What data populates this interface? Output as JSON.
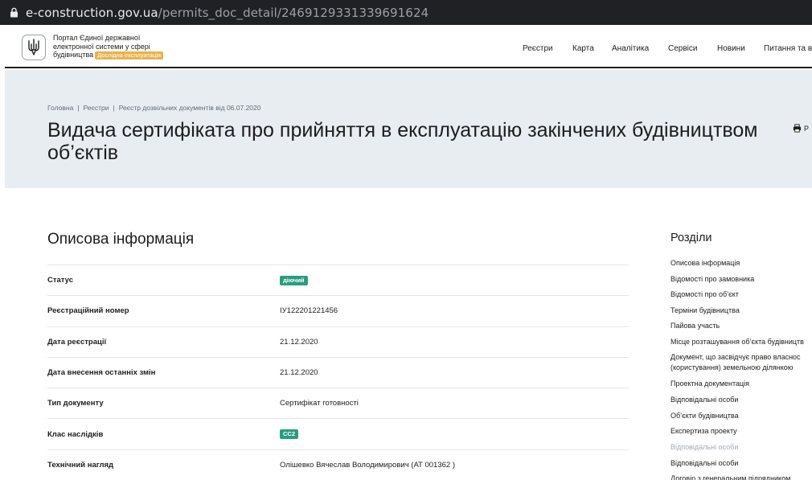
{
  "browser": {
    "url_domain": "e-construction.gov.ua",
    "url_path": "/permits_doc_detail/2469129331339691624"
  },
  "header": {
    "portal_line1": "Портал Єдиної державної",
    "portal_line2": "електронної системи у сфері",
    "portal_line3": "будівництва",
    "beta_badge": "Дослідна експлуатація",
    "nav": [
      {
        "label": "Реєстри"
      },
      {
        "label": "Карта"
      },
      {
        "label": "Аналітика"
      },
      {
        "label": "Сервіси"
      },
      {
        "label": "Новини"
      },
      {
        "label": "Питання та в"
      }
    ]
  },
  "hero": {
    "breadcrumb": [
      "Головна",
      "Реєстри",
      "Реєстр дозвільних документів від 06.07.2020"
    ],
    "title": "Видача сертифіката про прийняття в експлуатацію закінчених будівництвом об’єктів",
    "print_label": "Р"
  },
  "main": {
    "section_title": "Описова інформація",
    "rows": [
      {
        "label": "Статус",
        "value": "діючий",
        "badge": true
      },
      {
        "label": "Реєстраційний номер",
        "value": "ІУ122201221456",
        "badge": false
      },
      {
        "label": "Дата реєстрації",
        "value": "21.12.2020",
        "badge": false
      },
      {
        "label": "Дата внесення останніх змін",
        "value": "21.12.2020",
        "badge": false
      },
      {
        "label": "Тип документу",
        "value": "Сертифікат готовності",
        "badge": false
      },
      {
        "label": "Клас наслідків",
        "value": "СС2",
        "badge": true
      },
      {
        "label": "Технічний нагляд",
        "value": "Олішевко Вячеслав Володимирович (АТ 001362 )",
        "badge": false
      }
    ]
  },
  "sidebar": {
    "title": "Розділи",
    "items": [
      {
        "label": "Описова інформація",
        "muted": false
      },
      {
        "label": "Відомості про замовника",
        "muted": false
      },
      {
        "label": "Відомості про об’єкт",
        "muted": false
      },
      {
        "label": "Терміни будівництва",
        "muted": false
      },
      {
        "label": "Пайова участь",
        "muted": false
      },
      {
        "label": "Місце розташування об’єкта будівництв",
        "muted": false
      },
      {
        "label": "Документ, що засвідчує право власнос",
        "muted": false
      },
      {
        "label": "(користування) земельною ділянкою",
        "muted": false
      },
      {
        "label": "Проектна документація",
        "muted": false
      },
      {
        "label": "Відповідальні особи",
        "muted": false
      },
      {
        "label": "Об’єкти будівництва",
        "muted": false
      },
      {
        "label": "Експертиза проекту",
        "muted": false
      },
      {
        "label": "Відповідальні особи",
        "muted": true
      },
      {
        "label": "Відповідальні особи",
        "muted": false
      },
      {
        "label": "Договір з генеральним підрядником",
        "muted": false
      }
    ]
  },
  "colors": {
    "hero_bg": "#e8edf2",
    "badge_green": "#2a9d7f",
    "beta_orange": "#e8b34d",
    "browser_bar": "#202124"
  }
}
